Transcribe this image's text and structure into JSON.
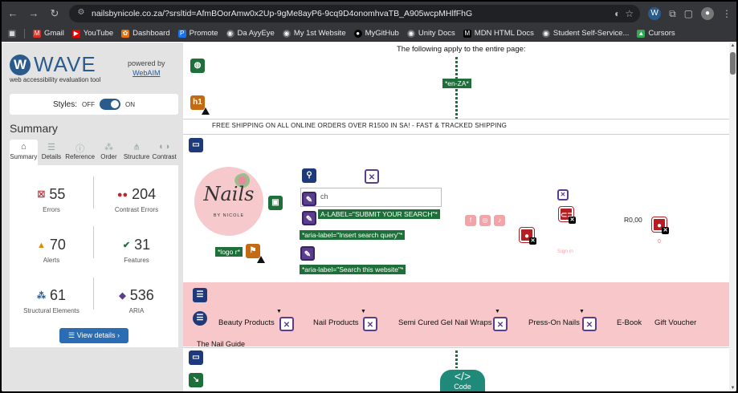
{
  "browser": {
    "url": "nailsbynicole.co.za/?srsltid=AfmBOorAmw0x2Up-9gMe8ayP6-9cq9D4onomhvaTB_A905wcpMHlfFhG",
    "bookmarks": [
      "Gmail",
      "YouTube",
      "Dashboard",
      "Promote",
      "Da AyyEye",
      "My 1st Website",
      "MyGitHub",
      "Unity Docs",
      "MDN HTML Docs",
      "Student Self-Service...",
      "Cursors"
    ]
  },
  "wave": {
    "logo_text": "WAVE",
    "subtitle": "web accessibility evaluation tool",
    "powered_by": "powered by",
    "powered_link": "WebAIM",
    "styles_label": "Styles:",
    "styles_off": "OFF",
    "styles_on": "ON",
    "summary_title": "Summary",
    "tabs": [
      "Summary",
      "Details",
      "Reference",
      "Order",
      "Structure",
      "Contrast"
    ],
    "stats": {
      "errors": {
        "value": "55",
        "label": "Errors"
      },
      "contrast": {
        "value": "204",
        "label": "Contrast Errors"
      },
      "alerts": {
        "value": "70",
        "label": "Alerts"
      },
      "features": {
        "value": "31",
        "label": "Features"
      },
      "structural": {
        "value": "61",
        "label": "Structural Elements"
      },
      "aria": {
        "value": "536",
        "label": "ARIA"
      }
    },
    "view_details": "View details ›"
  },
  "page": {
    "apply_text": "The following apply to the entire page:",
    "lang_label": "*en-ZA*",
    "shipping_banner": "FREE SHIPPING ON ALL ONLINE ORDERS OVER R1500 IN SA! - FAST & TRACKED SHIPPING",
    "logo_script": "Nails",
    "logo_sub": "BY NICOLE",
    "logo_alt_label": "*logo r*",
    "search_placeholder": "ch",
    "aria_submit": "A-LABEL=\"SUBMIT YOUR SEARCH\"*",
    "aria_insert": "*aria-label=\"Insert search query\"*",
    "aria_search_site": "*aria-label=\"Search this website\"*",
    "price": "R0,00",
    "cart_count": "0",
    "signin": "Sign in",
    "h1_icon": "h1",
    "nav_items": [
      "Beauty Products",
      "Nail Products",
      "Semi Cured Gel Nail Wraps",
      "Press-On Nails",
      "E-Book",
      "Gift Voucher"
    ],
    "nail_guide": "The Nail Guide",
    "code_label": "Code"
  }
}
